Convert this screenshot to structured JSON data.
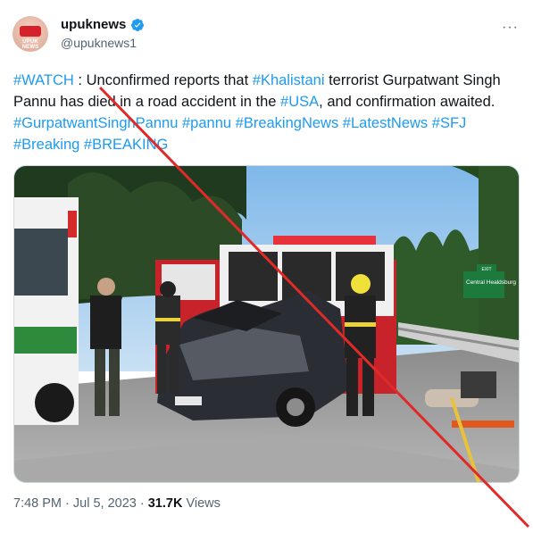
{
  "account": {
    "name": "upuknews",
    "handle": "@upuknews1",
    "verified": true,
    "avatar_logo_text": "UPUK NEWS"
  },
  "more_menu": "···",
  "tweet": {
    "tag_watch": "#WATCH",
    "part1": " : Unconfirmed reports that ",
    "tag_khalistani": "#Khalistani",
    "part2": " terrorist Gurpatwant Singh Pannu has died in a road accident in the ",
    "tag_usa": "#USA",
    "part3": ", and confirmation awaited. ",
    "hashtags": [
      "#GurpatwantSinghPannu",
      "#pannu",
      "#BreakingNews",
      "#LatestNews",
      "#SFJ",
      "#Breaking",
      "#BREAKING"
    ]
  },
  "photo": {
    "road_sign_exit": "EXIT",
    "road_sign_text": "Central Healdsburg"
  },
  "meta": {
    "time": "7:48 PM",
    "separator": " · ",
    "date": "Jul 5, 2023",
    "views_count": "31.7K",
    "views_label": " Views"
  },
  "colors": {
    "link": "#1d9bf0",
    "verified": "#1d9bf0",
    "strike": "#e02a2a",
    "muted": "#536471"
  }
}
